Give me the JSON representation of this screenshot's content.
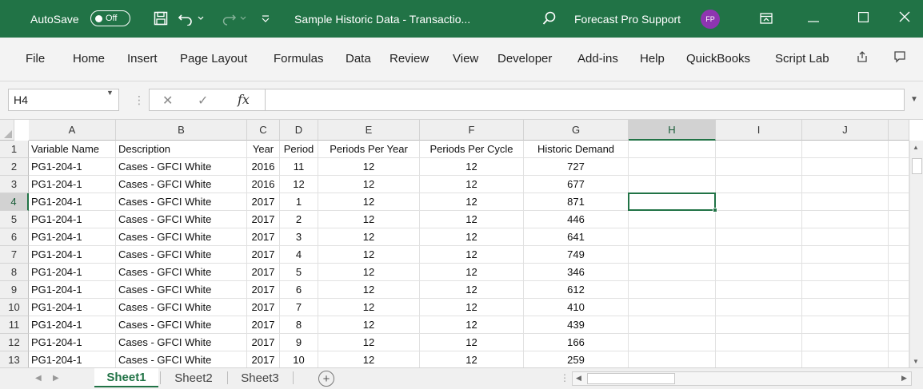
{
  "titlebar": {
    "autosave_label": "AutoSave",
    "autosave_state": "Off",
    "doc_title": "Sample Historic Data - Transactio...",
    "support_label": "Forecast Pro Support",
    "avatar_initials": "FP",
    "accent": "#217346",
    "avatar_color": "#8e35b0"
  },
  "menu": {
    "items": [
      "File",
      "Home",
      "Insert",
      "Page Layout",
      "Formulas",
      "Data",
      "Review",
      "View",
      "Developer",
      "Add-ins",
      "Help",
      "QuickBooks",
      "Script Lab"
    ]
  },
  "formula_bar": {
    "namebox": "H4",
    "cancel_glyph": "✕",
    "enter_glyph": "✓",
    "fx_label": "fx",
    "formula_value": ""
  },
  "grid": {
    "columns": [
      "A",
      "B",
      "C",
      "D",
      "E",
      "F",
      "G",
      "H",
      "I",
      "J"
    ],
    "active_column": "H",
    "active_row": "4",
    "rows": [
      {
        "n": "1",
        "cells": [
          "Variable Name",
          "Description",
          "Year",
          "Period",
          "Periods Per Year",
          "Periods Per Cycle",
          "Historic Demand"
        ]
      },
      {
        "n": "2",
        "cells": [
          "PG1-204-1",
          "Cases - GFCI White",
          "2016",
          "11",
          "12",
          "12",
          "727"
        ]
      },
      {
        "n": "3",
        "cells": [
          "PG1-204-1",
          "Cases - GFCI White",
          "2016",
          "12",
          "12",
          "12",
          "677"
        ]
      },
      {
        "n": "4",
        "cells": [
          "PG1-204-1",
          "Cases - GFCI White",
          "2017",
          "1",
          "12",
          "12",
          "871"
        ]
      },
      {
        "n": "5",
        "cells": [
          "PG1-204-1",
          "Cases - GFCI White",
          "2017",
          "2",
          "12",
          "12",
          "446"
        ]
      },
      {
        "n": "6",
        "cells": [
          "PG1-204-1",
          "Cases - GFCI White",
          "2017",
          "3",
          "12",
          "12",
          "641"
        ]
      },
      {
        "n": "7",
        "cells": [
          "PG1-204-1",
          "Cases - GFCI White",
          "2017",
          "4",
          "12",
          "12",
          "749"
        ]
      },
      {
        "n": "8",
        "cells": [
          "PG1-204-1",
          "Cases - GFCI White",
          "2017",
          "5",
          "12",
          "12",
          "346"
        ]
      },
      {
        "n": "9",
        "cells": [
          "PG1-204-1",
          "Cases - GFCI White",
          "2017",
          "6",
          "12",
          "12",
          "612"
        ]
      },
      {
        "n": "10",
        "cells": [
          "PG1-204-1",
          "Cases - GFCI White",
          "2017",
          "7",
          "12",
          "12",
          "410"
        ]
      },
      {
        "n": "11",
        "cells": [
          "PG1-204-1",
          "Cases - GFCI White",
          "2017",
          "8",
          "12",
          "12",
          "439"
        ]
      },
      {
        "n": "12",
        "cells": [
          "PG1-204-1",
          "Cases - GFCI White",
          "2017",
          "9",
          "12",
          "12",
          "166"
        ]
      },
      {
        "n": "13",
        "cells": [
          "PG1-204-1",
          "Cases - GFCI White",
          "2017",
          "10",
          "12",
          "12",
          "259"
        ]
      }
    ]
  },
  "sheets": {
    "tabs": [
      "Sheet1",
      "Sheet2",
      "Sheet3"
    ],
    "active": "Sheet1"
  }
}
